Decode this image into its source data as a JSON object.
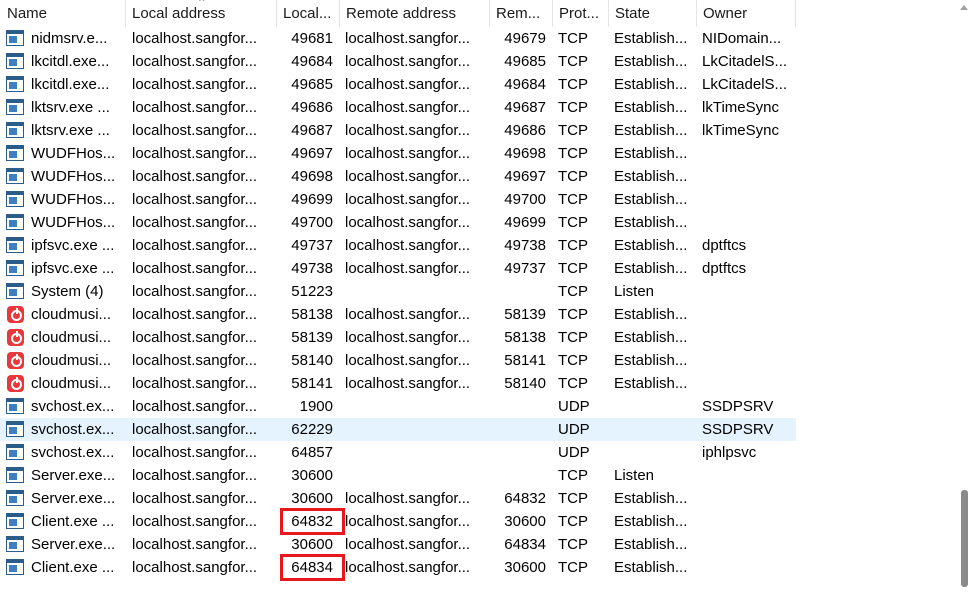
{
  "columns": [
    {
      "key": "name",
      "label": "Name"
    },
    {
      "key": "local_address",
      "label": "Local address"
    },
    {
      "key": "local_port",
      "label": "Local..."
    },
    {
      "key": "remote_address",
      "label": "Remote address"
    },
    {
      "key": "remote_port",
      "label": "Rem..."
    },
    {
      "key": "protocol",
      "label": "Prot..."
    },
    {
      "key": "state",
      "label": "State"
    },
    {
      "key": "owner",
      "label": "Owner"
    }
  ],
  "rows": [
    {
      "icon": "app-window-icon",
      "name": "nidmsrv.e...",
      "local_address": "localhost.sangfor...",
      "local_port": "49681",
      "remote_address": "localhost.sangfor...",
      "remote_port": "49679",
      "protocol": "TCP",
      "state": "Establish...",
      "owner": "NIDomain..."
    },
    {
      "icon": "app-window-icon",
      "name": "lkcitdl.exe...",
      "local_address": "localhost.sangfor...",
      "local_port": "49684",
      "remote_address": "localhost.sangfor...",
      "remote_port": "49685",
      "protocol": "TCP",
      "state": "Establish...",
      "owner": "LkCitadelS..."
    },
    {
      "icon": "app-window-icon",
      "name": "lkcitdl.exe...",
      "local_address": "localhost.sangfor...",
      "local_port": "49685",
      "remote_address": "localhost.sangfor...",
      "remote_port": "49684",
      "protocol": "TCP",
      "state": "Establish...",
      "owner": "LkCitadelS..."
    },
    {
      "icon": "app-window-icon",
      "name": "lktsrv.exe ...",
      "local_address": "localhost.sangfor...",
      "local_port": "49686",
      "remote_address": "localhost.sangfor...",
      "remote_port": "49687",
      "protocol": "TCP",
      "state": "Establish...",
      "owner": "lkTimeSync"
    },
    {
      "icon": "app-window-icon",
      "name": "lktsrv.exe ...",
      "local_address": "localhost.sangfor...",
      "local_port": "49687",
      "remote_address": "localhost.sangfor...",
      "remote_port": "49686",
      "protocol": "TCP",
      "state": "Establish...",
      "owner": "lkTimeSync"
    },
    {
      "icon": "app-window-icon",
      "name": "WUDFHos...",
      "local_address": "localhost.sangfor...",
      "local_port": "49697",
      "remote_address": "localhost.sangfor...",
      "remote_port": "49698",
      "protocol": "TCP",
      "state": "Establish...",
      "owner": ""
    },
    {
      "icon": "app-window-icon",
      "name": "WUDFHos...",
      "local_address": "localhost.sangfor...",
      "local_port": "49698",
      "remote_address": "localhost.sangfor...",
      "remote_port": "49697",
      "protocol": "TCP",
      "state": "Establish...",
      "owner": ""
    },
    {
      "icon": "app-window-icon",
      "name": "WUDFHos...",
      "local_address": "localhost.sangfor...",
      "local_port": "49699",
      "remote_address": "localhost.sangfor...",
      "remote_port": "49700",
      "protocol": "TCP",
      "state": "Establish...",
      "owner": ""
    },
    {
      "icon": "app-window-icon",
      "name": "WUDFHos...",
      "local_address": "localhost.sangfor...",
      "local_port": "49700",
      "remote_address": "localhost.sangfor...",
      "remote_port": "49699",
      "protocol": "TCP",
      "state": "Establish...",
      "owner": ""
    },
    {
      "icon": "app-window-icon",
      "name": "ipfsvc.exe ...",
      "local_address": "localhost.sangfor...",
      "local_port": "49737",
      "remote_address": "localhost.sangfor...",
      "remote_port": "49738",
      "protocol": "TCP",
      "state": "Establish...",
      "owner": "dptftcs"
    },
    {
      "icon": "app-window-icon",
      "name": "ipfsvc.exe ...",
      "local_address": "localhost.sangfor...",
      "local_port": "49738",
      "remote_address": "localhost.sangfor...",
      "remote_port": "49737",
      "protocol": "TCP",
      "state": "Establish...",
      "owner": "dptftcs"
    },
    {
      "icon": "app-window-icon",
      "name": "System (4)",
      "local_address": "localhost.sangfor...",
      "local_port": "51223",
      "remote_address": "",
      "remote_port": "",
      "protocol": "TCP",
      "state": "Listen",
      "owner": ""
    },
    {
      "icon": "cloudmusic-icon",
      "name": "cloudmusi...",
      "local_address": "localhost.sangfor...",
      "local_port": "58138",
      "remote_address": "localhost.sangfor...",
      "remote_port": "58139",
      "protocol": "TCP",
      "state": "Establish...",
      "owner": ""
    },
    {
      "icon": "cloudmusic-icon",
      "name": "cloudmusi...",
      "local_address": "localhost.sangfor...",
      "local_port": "58139",
      "remote_address": "localhost.sangfor...",
      "remote_port": "58138",
      "protocol": "TCP",
      "state": "Establish...",
      "owner": ""
    },
    {
      "icon": "cloudmusic-icon",
      "name": "cloudmusi...",
      "local_address": "localhost.sangfor...",
      "local_port": "58140",
      "remote_address": "localhost.sangfor...",
      "remote_port": "58141",
      "protocol": "TCP",
      "state": "Establish...",
      "owner": ""
    },
    {
      "icon": "cloudmusic-icon",
      "name": "cloudmusi...",
      "local_address": "localhost.sangfor...",
      "local_port": "58141",
      "remote_address": "localhost.sangfor...",
      "remote_port": "58140",
      "protocol": "TCP",
      "state": "Establish...",
      "owner": ""
    },
    {
      "icon": "app-window-icon",
      "name": "svchost.ex...",
      "local_address": "localhost.sangfor...",
      "local_port": "1900",
      "remote_address": "",
      "remote_port": "",
      "protocol": "UDP",
      "state": "",
      "owner": "SSDPSRV"
    },
    {
      "icon": "app-window-icon",
      "name": "svchost.ex...",
      "local_address": "localhost.sangfor...",
      "local_port": "62229",
      "remote_address": "",
      "remote_port": "",
      "protocol": "UDP",
      "state": "",
      "owner": "SSDPSRV",
      "selected": true
    },
    {
      "icon": "app-window-icon",
      "name": "svchost.ex...",
      "local_address": "localhost.sangfor...",
      "local_port": "64857",
      "remote_address": "",
      "remote_port": "",
      "protocol": "UDP",
      "state": "",
      "owner": "iphlpsvc"
    },
    {
      "icon": "app-window-icon",
      "name": "Server.exe...",
      "local_address": "localhost.sangfor...",
      "local_port": "30600",
      "remote_address": "",
      "remote_port": "",
      "protocol": "TCP",
      "state": "Listen",
      "owner": ""
    },
    {
      "icon": "app-window-icon",
      "name": "Server.exe...",
      "local_address": "localhost.sangfor...",
      "local_port": "30600",
      "remote_address": "localhost.sangfor...",
      "remote_port": "64832",
      "protocol": "TCP",
      "state": "Establish...",
      "owner": ""
    },
    {
      "icon": "app-window-icon",
      "name": "Client.exe ...",
      "local_address": "localhost.sangfor...",
      "local_port": "64832",
      "remote_address": "localhost.sangfor...",
      "remote_port": "30600",
      "protocol": "TCP",
      "state": "Establish...",
      "owner": "",
      "highlight_local_port": true
    },
    {
      "icon": "app-window-icon",
      "name": "Server.exe...",
      "local_address": "localhost.sangfor...",
      "local_port": "30600",
      "remote_address": "localhost.sangfor...",
      "remote_port": "64834",
      "protocol": "TCP",
      "state": "Establish...",
      "owner": ""
    },
    {
      "icon": "app-window-icon",
      "name": "Client.exe ...",
      "local_address": "localhost.sangfor...",
      "local_port": "64834",
      "remote_address": "localhost.sangfor...",
      "remote_port": "30600",
      "protocol": "TCP",
      "state": "Establish...",
      "owner": "",
      "highlight_local_port": true
    }
  ],
  "annotation_color": "#e8181e",
  "selection_color": "#e5f3ff"
}
